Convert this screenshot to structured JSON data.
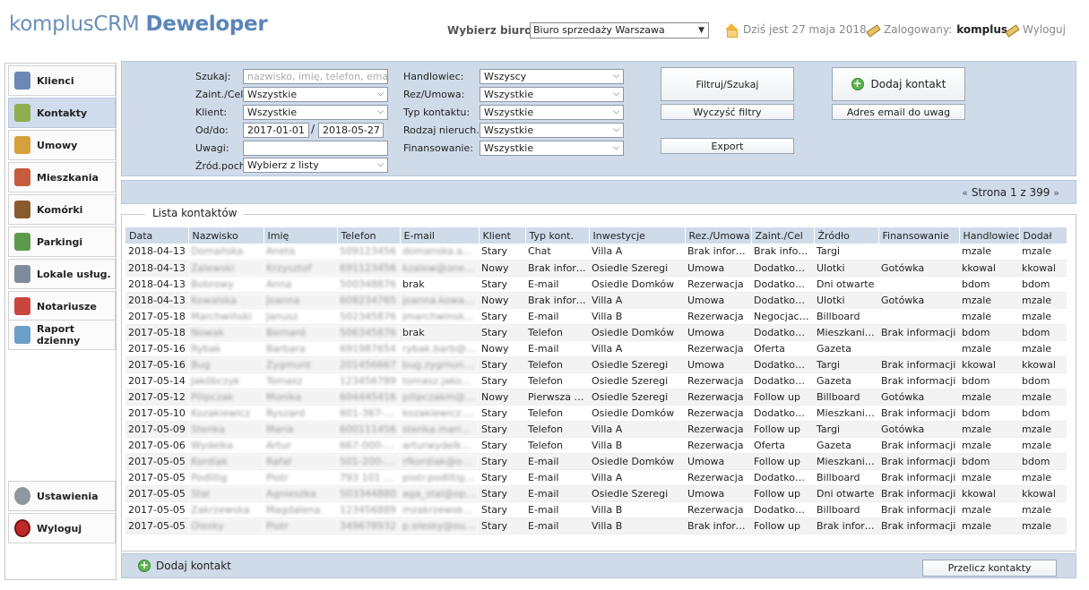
{
  "app": {
    "name": "komplusCRM",
    "edition": "Deweloper"
  },
  "header": {
    "office_label": "Wybierz biuro:",
    "office_value": "Biuro sprzedaży Warszawa",
    "date_text": "Dziś jest 27 maja 2018",
    "logged_label": "Zalogowany:",
    "logged_user": "komplus",
    "logout_label": "Wyloguj"
  },
  "sidebar": {
    "items": [
      {
        "label": "Klienci",
        "icon": "user-icon",
        "color": "#6b88b6"
      },
      {
        "label": "Kontakty",
        "icon": "clipboard-check-icon",
        "color": "#8fae4f"
      },
      {
        "label": "Umowy",
        "icon": "money-bag-icon",
        "color": "#d6a13c"
      },
      {
        "label": "Mieszkania",
        "icon": "house-icon",
        "color": "#c65b3d"
      },
      {
        "label": "Komórki",
        "icon": "door-icon",
        "color": "#8a5a2f"
      },
      {
        "label": "Parkingi",
        "icon": "traffic-light-icon",
        "color": "#5d9a4c"
      },
      {
        "label": "Lokale usług.",
        "icon": "document-icon",
        "color": "#7f8c9e"
      },
      {
        "label": "Notariusze",
        "icon": "calendar-icon",
        "color": "#c8463e"
      },
      {
        "label": "Raport dzienny",
        "icon": "chart-icon",
        "color": "#6aa0c8"
      }
    ],
    "settings_label": "Ustawienia",
    "logout_label": "Wyloguj"
  },
  "filters": {
    "search_label": "Szukaj:",
    "search_placeholder": "nazwisko, imię, telefon, email",
    "interest_label": "Zaint./Cel:",
    "interest_value": "Wszystkie",
    "client_label": "Klient:",
    "client_value": "Wszystkie",
    "date_label": "Od/do:",
    "date_from": "2017-01-01",
    "date_sep": "/",
    "date_to": "2018-05-27",
    "notes_label": "Uwagi:",
    "notes_value": "",
    "source_label": "Źród.poch.:",
    "source_value": "Wybierz z listy",
    "salesman_label": "Handlowiec:",
    "salesman_value": "Wszyscy",
    "reservation_label": "Rez/Umowa:",
    "reservation_value": "Wszystkie",
    "contact_type_label": "Typ kontaktu:",
    "contact_type_value": "Wszystkie",
    "property_type_label": "Rodzaj nieruch.:",
    "property_type_value": "Wszystkie",
    "financing_label": "Finansowanie:",
    "financing_value": "Wszystkie",
    "filter_button": "Filtruj/Szukaj",
    "clear_button": "Wyczyść filtry",
    "export_button": "Export",
    "add_contact_button": "Dodaj kontakt",
    "email_notes_button": "Adres email do uwag"
  },
  "pagination": {
    "prev": "«",
    "text": "Strona 1 z 399",
    "next": "»"
  },
  "list": {
    "title": "Lista kontaktów",
    "columns": [
      "Data",
      "Nazwisko",
      "Imię",
      "Telefon",
      "E-mail",
      "Klient",
      "Typ kont.",
      "Inwestycje",
      "Rez./Umowa",
      "Zaint./Cel",
      "Źródło",
      "Finansowanie",
      "Handlowiec",
      "Dodał"
    ],
    "rows": [
      [
        "2018-04-13",
        "Domańska",
        "Aneta",
        "509123456",
        "domanska.aneta@wp.pl",
        "Stary",
        "Chat",
        "Villa A",
        "Brak informacji",
        "Brak informacji",
        "Targi",
        "",
        "mzale",
        "mzale"
      ],
      [
        "2018-04-13",
        "Zalewski",
        "Krzysztof",
        "691123456",
        "kzalew@onet.pl",
        "Nowy",
        "Brak informacji",
        "Osiedle Szeregi",
        "Umowa",
        "Dodatkowe i...",
        "Ulotki",
        "Gotówka",
        "kkowal",
        "kkowal"
      ],
      [
        "2018-04-13",
        "Bobrowy",
        "Anna",
        "500348876",
        "brak",
        "Stary",
        "E-mail",
        "Osiedle Domków",
        "Rezerwacja",
        "Dodatkowe i...",
        "Dni otwarte",
        "",
        "bdom",
        "bdom"
      ],
      [
        "2018-04-13",
        "Kowalska",
        "Joanna",
        "608234765",
        "joanna.kowalska@o2.pl",
        "Nowy",
        "Brak informacji",
        "Villa A",
        "Umowa",
        "Dodatkowe i...",
        "Ulotki",
        "Gotówka",
        "mzale",
        "mzale"
      ],
      [
        "2017-05-18",
        "Marchwiński",
        "Janusz",
        "502345876",
        "jmarchwinski@gmail.com",
        "Stary",
        "E-mail",
        "Villa B",
        "Rezerwacja",
        "Negocjacja c...",
        "Billboard",
        "",
        "mzale",
        "mzale"
      ],
      [
        "2017-05-18",
        "Nowak",
        "Bernard",
        "506345876",
        "brak",
        "Stary",
        "Telefon",
        "Osiedle Domków",
        "Umowa",
        "Dodatkowe i...",
        "Mieszkaniec ...",
        "Brak informacji",
        "bdom",
        "bdom"
      ],
      [
        "2017-05-16",
        "Rybak",
        "Barbara",
        "691987654",
        "rybak.barb@onet.pl",
        "Nowy",
        "E-mail",
        "Villa A",
        "Rezerwacja",
        "Oferta",
        "Gazeta",
        "",
        "mzale",
        "mzale"
      ],
      [
        "2017-05-16",
        "Bug",
        "Zygmunt",
        "201456667",
        "bug.zygmunt@wp.pl",
        "Stary",
        "Telefon",
        "Osiedle Szeregi",
        "Umowa",
        "Dodatkowe i...",
        "Targi",
        "Brak informacji",
        "kkowal",
        "kkowal"
      ],
      [
        "2017-05-14",
        "Jakóbczyk",
        "Tomasz",
        "123456789",
        "tomasz.jakobczyk@o2.pl",
        "Stary",
        "Telefon",
        "Osiedle Szeregi",
        "Rezerwacja",
        "Dodatkowe i...",
        "Gazeta",
        "Brak informacji",
        "bdom",
        "bdom"
      ],
      [
        "2017-05-12",
        "Pilipczak",
        "Monika",
        "604445416",
        "pilipczakm@gmail.com",
        "Nowy",
        "Pierwsza wiz...",
        "Osiedle Szeregi",
        "Rezerwacja",
        "Follow up",
        "Billboard",
        "Gotówka",
        "mzale",
        "mzale"
      ],
      [
        "2017-05-10",
        "Kozakiewicz",
        "Ryszard",
        "601-367-177",
        "kozakiewicz.ryszard@wp.pl",
        "Stary",
        "Telefon",
        "Osiedle Domków",
        "Rezerwacja",
        "Dodatkowe i...",
        "Mieszkaniec...",
        "Brak informacji",
        "bdom",
        "bdom"
      ],
      [
        "2017-05-09",
        "Stenka",
        "Maria",
        "600111456",
        "stenka.maria@gmail.com",
        "Stary",
        "Telefon",
        "Villa A",
        "Rezerwacja",
        "Follow up",
        "Targi",
        "Gotówka",
        "mzale",
        "mzale"
      ],
      [
        "2017-05-06",
        "Wydelka",
        "Artur",
        "667-000-178",
        "arturwydelka@gmail.com",
        "Stary",
        "Telefon",
        "Villa B",
        "Rezerwacja",
        "Oferta",
        "Gazeta",
        "Brak informacji",
        "mzale",
        "mzale"
      ],
      [
        "2017-05-05",
        "Kordiak",
        "Rafał",
        "501-200-271",
        "rfkordiak@o2.pl",
        "Stary",
        "E-mail",
        "Osiedle Domków",
        "Umowa",
        "Follow up",
        "Mieszkaniec ...",
        "Brak informacji",
        "bdom",
        "bdom"
      ],
      [
        "2017-05-05",
        "Podlitig",
        "Piotr",
        "793 101 137",
        "piotr.podlitig@wp.pl",
        "Stary",
        "E-mail",
        "Villa A",
        "Rezerwacja",
        "Dodatkowe i...",
        "Billboard",
        "Brak informacji",
        "mzale",
        "mzale"
      ],
      [
        "2017-05-05",
        "Stal",
        "Agnieszka",
        "503344880",
        "aga_stal@op.pl",
        "Stary",
        "E-mail",
        "Osiedle Szeregi",
        "Umowa",
        "Follow up",
        "Dni otwarte",
        "Brak informacji",
        "kkowal",
        "kkowal"
      ],
      [
        "2017-05-05",
        "Zakrzewska",
        "Magdalena",
        "123456889",
        "mzakrzewska@yahoo.com",
        "Stary",
        "E-mail",
        "Villa B",
        "Rezerwacja",
        "Dodatkowe i...",
        "Billboard",
        "Brak informacji",
        "mzale",
        "mzale"
      ],
      [
        "2017-05-05",
        "Olesky",
        "Piotr",
        "349678932",
        "p.olesky@outlook.com",
        "Stary",
        "E-mail",
        "Villa B",
        "Brak informacji",
        "Follow up",
        "Brak informa...",
        "Brak informacji",
        "mzale",
        "mzale"
      ]
    ]
  },
  "footer": {
    "add_contact_label": "Dodaj kontakt",
    "recalc_button": "Przelicz kontakty"
  }
}
